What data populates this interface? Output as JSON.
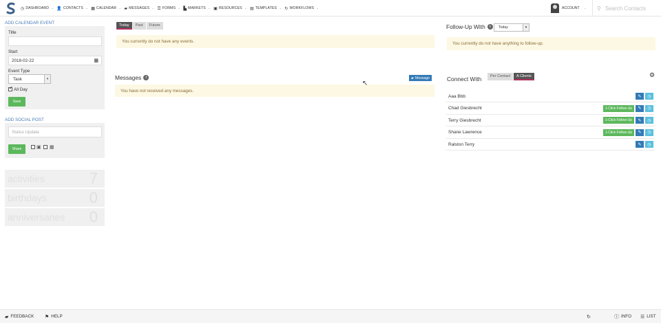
{
  "nav": {
    "items": [
      {
        "label": "DASHBOARD",
        "icon": "gauge-icon",
        "glyph": "◷"
      },
      {
        "label": "CONTACTS",
        "icon": "user-icon",
        "glyph": "👤"
      },
      {
        "label": "CALENDAR",
        "icon": "calendar-icon",
        "glyph": "▦"
      },
      {
        "label": "MESSAGES",
        "icon": "comment-icon",
        "glyph": "▰"
      },
      {
        "label": "FORMS",
        "icon": "list-icon",
        "glyph": "☰"
      },
      {
        "label": "MARKETS",
        "icon": "chart-icon",
        "glyph": "▙"
      },
      {
        "label": "RESOURCES",
        "icon": "briefcase-icon",
        "glyph": "▣"
      },
      {
        "label": "TEMPLATES",
        "icon": "file-icon",
        "glyph": "▤"
      },
      {
        "label": "WORKFLOWS",
        "icon": "refresh-icon",
        "glyph": "↻"
      }
    ],
    "account": "ACCOUNT",
    "search_placeholder": "Search Contacts"
  },
  "calendar_event": {
    "section_title": "ADD CALENDAR EVENT",
    "title_label": "Title",
    "title_value": "",
    "start_label": "Start",
    "start_value": "2018-02-22",
    "event_type_label": "Event Type",
    "event_type_value": "Task",
    "all_day_label": "All Day",
    "all_day_checked": true,
    "save_label": "Save"
  },
  "social_post": {
    "section_title": "ADD SOCIAL POST",
    "status_placeholder": "Status Update",
    "share_label": "Share"
  },
  "stats": [
    {
      "name": "activities",
      "value": "7"
    },
    {
      "name": "birthdays",
      "value": "0"
    },
    {
      "name": "anniversaries",
      "value": "0"
    }
  ],
  "events": {
    "tabs": [
      "Today",
      "Past",
      "Future"
    ],
    "active_tab": "Today",
    "notice": "You currently do not have any events."
  },
  "messages": {
    "heading": "Messages",
    "button_label": "Message",
    "notice": "You have not received any messages."
  },
  "followup": {
    "heading": "Follow-Up With",
    "select_value": "Today",
    "notice": "You currently do not have anything to follow-up."
  },
  "connect": {
    "heading": "Connect With",
    "tabs": [
      "Per Contact",
      "A Clients"
    ],
    "active_tab": "A Clients",
    "followup_label": "1-Click Follow-Up",
    "contacts": [
      {
        "name": "Aaa Bbb",
        "followup": false
      },
      {
        "name": "Chad Giesbrecht",
        "followup": true
      },
      {
        "name": "Terry Giesbrecht",
        "followup": true
      },
      {
        "name": "Shane Lawrence",
        "followup": true
      },
      {
        "name": "Ralston Terry",
        "followup": false
      }
    ]
  },
  "footer": {
    "feedback": "FEEDBACK",
    "help": "HELP",
    "info": "INFO",
    "list": "LIST"
  },
  "colors": {
    "link_blue": "#4a7db8",
    "green": "#5cb85c",
    "primary": "#337ab7",
    "info": "#5bc0de",
    "warning_bg": "#fcf8e3",
    "warning_text": "#8a6d3b",
    "active_tab_accent": "#b03060"
  }
}
